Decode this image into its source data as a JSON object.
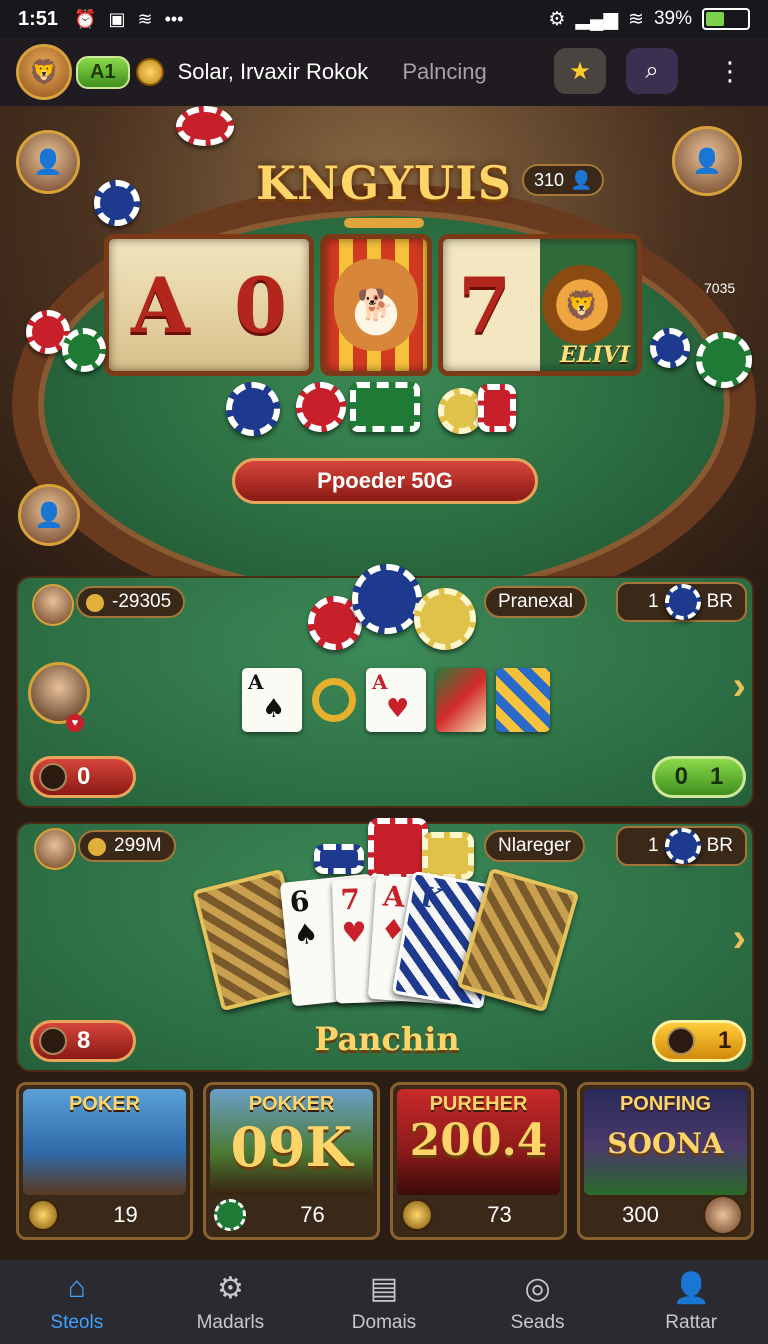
{
  "statusbar": {
    "time": "1:51",
    "battery": "39%"
  },
  "header": {
    "level": "A1",
    "username": "Solar, Irvaxir Rokok",
    "status": "Palncing"
  },
  "table": {
    "title": "KNGYUIS",
    "score": "310",
    "player_value": "7035",
    "reel_label": "ELIVI",
    "reels": [
      "A",
      "0",
      "7"
    ],
    "spin_button": "Ppoeder 50G"
  },
  "row1": {
    "left_pill": "-29305",
    "right_pill": "Pranexal",
    "right_badge_num": "1",
    "right_badge_text": "BR",
    "cards": [
      {
        "rank": "A",
        "suit": "♠"
      },
      {
        "rank": "A",
        "suit": "♥"
      }
    ],
    "bet_left": "0",
    "bet_right_a": "0",
    "bet_right_b": "1"
  },
  "row2": {
    "left_pill": "299M",
    "right_pill": "Nlareger",
    "right_badge_num": "1",
    "right_badge_text": "BR",
    "fan_cards": [
      "6",
      "7",
      "A",
      "K"
    ],
    "label": "Panchin",
    "bet_left": "8",
    "bet_right": "1"
  },
  "tiles": [
    {
      "title": "POKER",
      "big": "",
      "value": "19",
      "color": "#2e6aa8"
    },
    {
      "title": "POKKER",
      "big": "09K",
      "value": "76",
      "color": "#4a7a34"
    },
    {
      "title": "PUREHER",
      "big": "200.4",
      "value": "73",
      "color": "#8a1a1a"
    },
    {
      "title": "PONFING",
      "big": "SOONA",
      "value": "300",
      "color": "#2a2a5a"
    }
  ],
  "nav": [
    {
      "label": "Steols",
      "icon": "home-icon",
      "active": true
    },
    {
      "label": "Madarls",
      "icon": "gear-icon",
      "active": false
    },
    {
      "label": "Domais",
      "icon": "clipboard-icon",
      "active": false
    },
    {
      "label": "Seads",
      "icon": "dots-circle-icon",
      "active": false
    },
    {
      "label": "Rattar",
      "icon": "person-icon",
      "active": false
    }
  ]
}
